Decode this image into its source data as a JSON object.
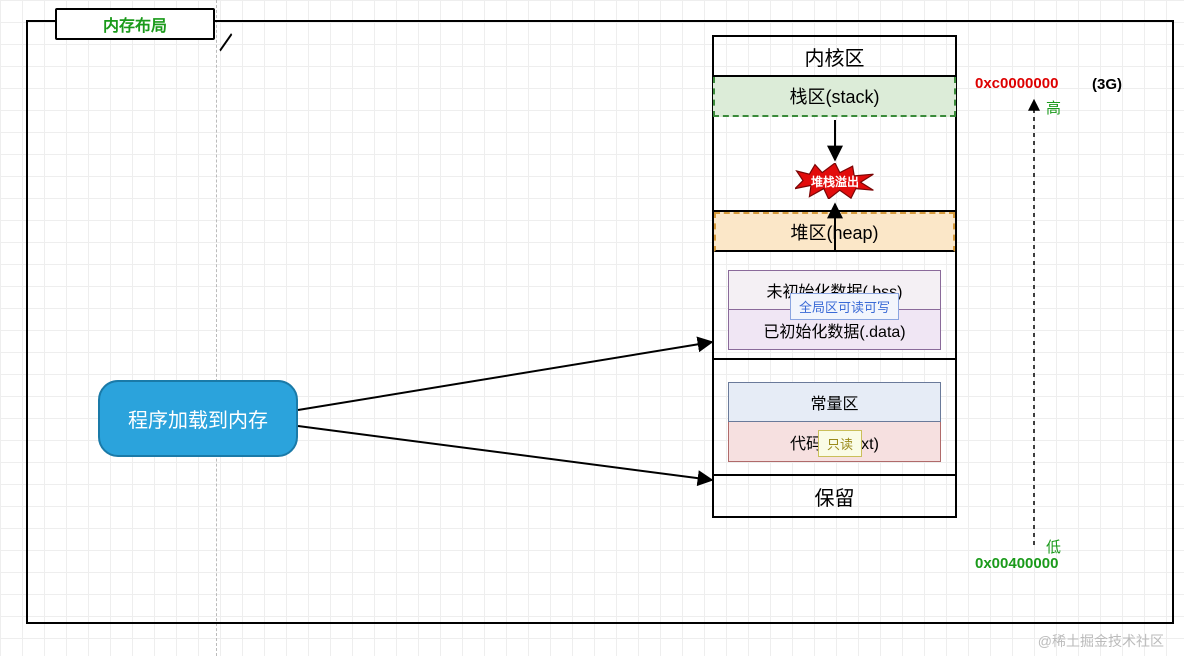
{
  "title": "内存布局",
  "source_node": "程序加载到内存",
  "memory": {
    "kernel": "内核区",
    "stack": "栈区(stack)",
    "overflow": "堆栈溢出",
    "heap": "堆区(heap)",
    "rw_tag": "全局区可读可写",
    "bss": "未初始化数据(.bss)",
    "data": "已初始化数据(.data)",
    "ro_tag": "只读",
    "const": "常量区",
    "text": "代码段(.text)",
    "reserve": "保留"
  },
  "addresses": {
    "high": "0xc0000000",
    "high_label": "高",
    "size_note": "(3G)",
    "low": "0x00400000",
    "low_label": "低"
  },
  "watermark": "@稀土掘金技术社区"
}
